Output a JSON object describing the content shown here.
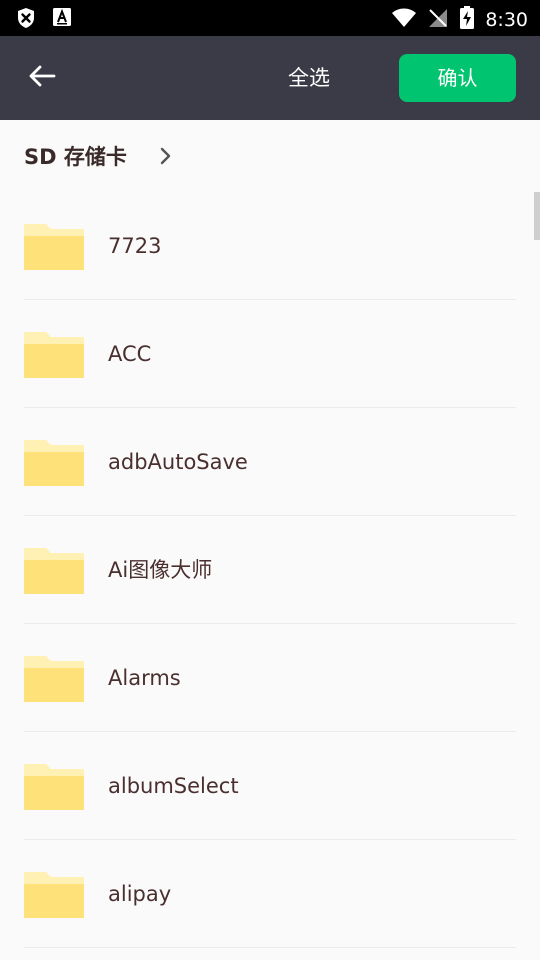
{
  "status_bar": {
    "time": "8:30",
    "left_icons": [
      "shield-close-icon",
      "a-notification-icon"
    ],
    "right_icons": [
      "wifi-icon",
      "no-signal-icon",
      "battery-charging-icon"
    ]
  },
  "top_bar": {
    "back_icon": "arrow-left-icon",
    "select_all_label": "全选",
    "confirm_label": "确认",
    "confirm_color": "#00c46f",
    "background_color": "#3b3b48"
  },
  "breadcrumb": {
    "label": "SD 存储卡",
    "chevron_icon": "chevron-right-icon"
  },
  "folders": [
    {
      "name": "7723"
    },
    {
      "name": "ACC"
    },
    {
      "name": "adbAutoSave"
    },
    {
      "name": "Ai图像大师"
    },
    {
      "name": "Alarms"
    },
    {
      "name": "albumSelect"
    },
    {
      "name": "alipay"
    }
  ],
  "folder_color": "#ffe17a"
}
